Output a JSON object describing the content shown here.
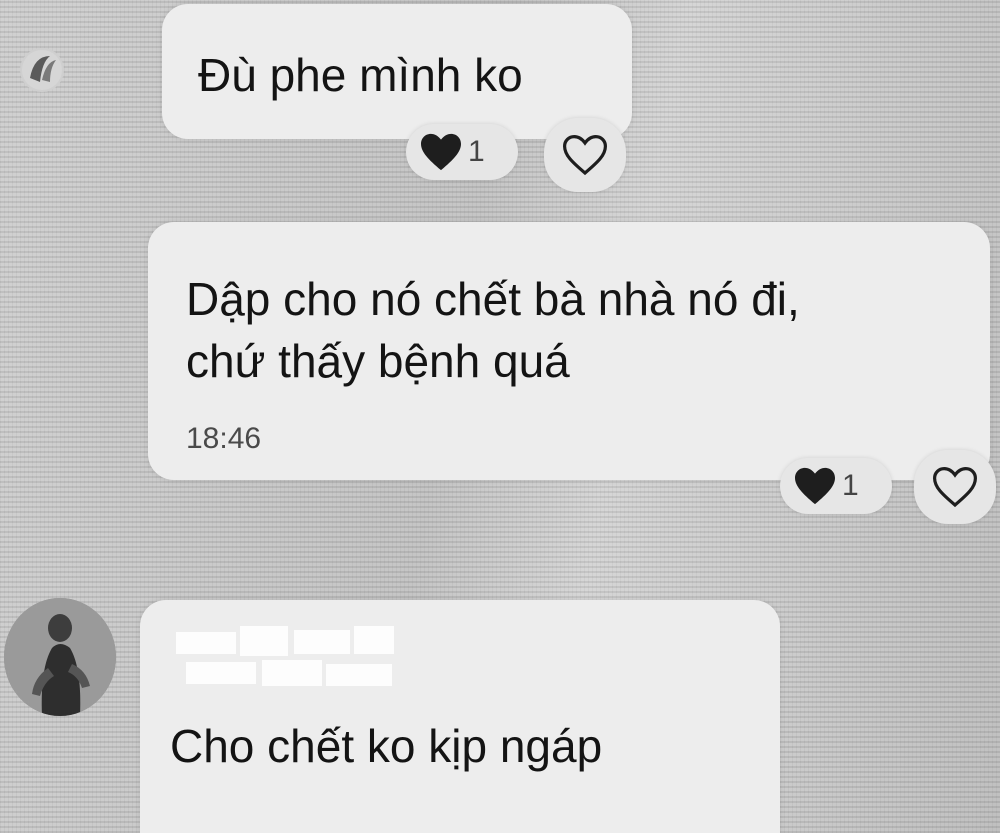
{
  "messages": [
    {
      "text": "Đù phe mình ko",
      "reactions": {
        "count": "1"
      }
    },
    {
      "line1": "Dập cho nó chết bà nhà nó đi,",
      "line2": "chứ thấy bệnh quá",
      "time": "18:46",
      "reactions": {
        "count": "1"
      }
    },
    {
      "text": "Cho chết ko kịp ngáp"
    }
  ],
  "colors": {
    "bubble": "#ededed",
    "background": "#c9c9c9",
    "heart": "#1e1e1e"
  },
  "icons": [
    "avatar",
    "heart-filled-icon",
    "heart-outline-icon"
  ]
}
